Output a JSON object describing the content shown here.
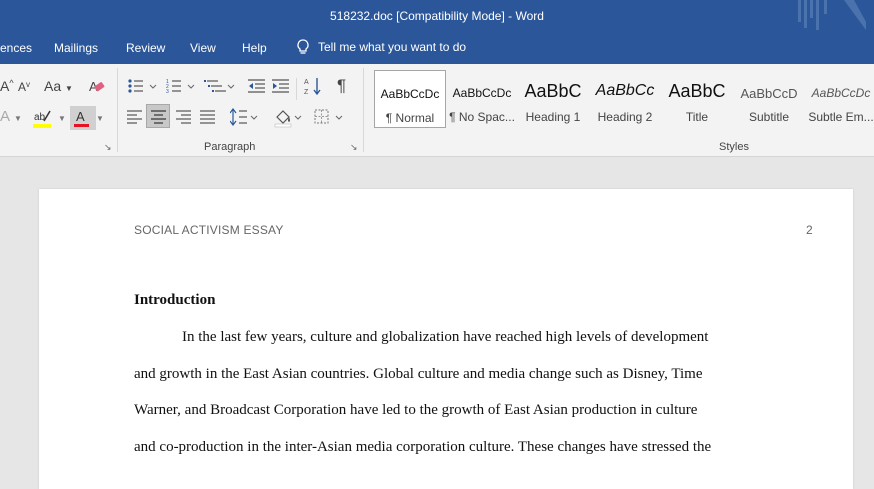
{
  "window": {
    "title": "518232.doc [Compatibility Mode]  -  Word"
  },
  "tabs": [
    "ences",
    "Mailings",
    "Review",
    "View",
    "Help"
  ],
  "tell_me": "Tell me what you want to do",
  "ribbon": {
    "font_size_buttons": [
      "A",
      "A"
    ],
    "change_case": "Aa",
    "paragraph_group_label": "Paragraph",
    "styles_group_label": "Styles",
    "styles": [
      {
        "preview": "AaBbCcDc",
        "name": "¶ Normal"
      },
      {
        "preview": "AaBbCcDc",
        "name": "¶ No Spac..."
      },
      {
        "preview": "AaBbC",
        "name": "Heading 1"
      },
      {
        "preview": "AaBbCc",
        "name": "Heading 2"
      },
      {
        "preview": "AaBbC",
        "name": "Title"
      },
      {
        "preview": "AaBbCcD",
        "name": "Subtitle"
      },
      {
        "preview": "AaBbCcDc",
        "name": "Subtle Em..."
      }
    ],
    "colors": {
      "titlebar": "#2b579a",
      "highlight": "#ffff00",
      "font_color": "#e81123"
    }
  },
  "document": {
    "header": "SOCIAL ACTIVISM ESSAY",
    "page_number": "2",
    "heading": "Introduction",
    "lines": [
      "In the last few years, culture and globalization have reached high levels of development",
      "and growth in the East Asian countries. Global culture and media change such as Disney, Time",
      "Warner, and Broadcast Corporation have led to the growth of East Asian production in culture",
      "and co-production in the inter-Asian media corporation culture. These changes have stressed the"
    ]
  }
}
